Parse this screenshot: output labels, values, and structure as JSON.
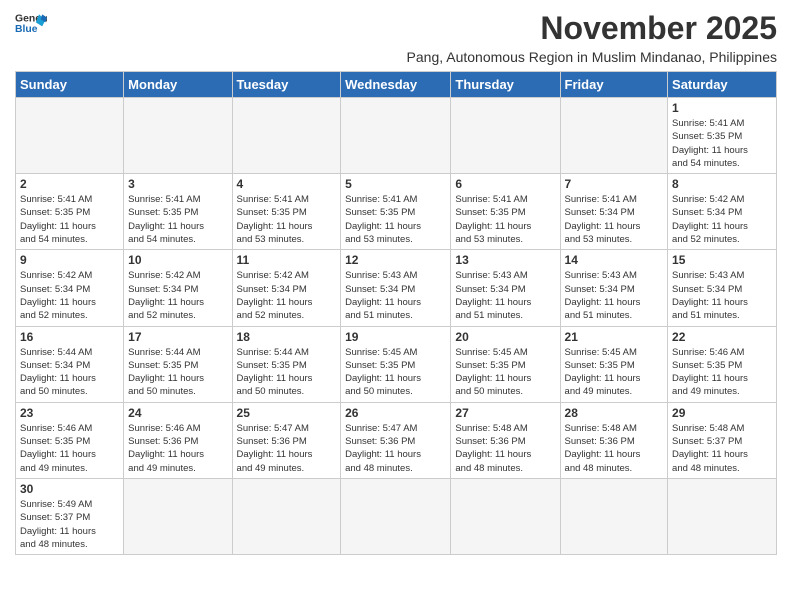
{
  "logo": {
    "line1": "General",
    "line2": "Blue"
  },
  "title": "November 2025",
  "subtitle": "Pang, Autonomous Region in Muslim Mindanao, Philippines",
  "days_of_week": [
    "Sunday",
    "Monday",
    "Tuesday",
    "Wednesday",
    "Thursday",
    "Friday",
    "Saturday"
  ],
  "weeks": [
    [
      {
        "day": "",
        "info": ""
      },
      {
        "day": "",
        "info": ""
      },
      {
        "day": "",
        "info": ""
      },
      {
        "day": "",
        "info": ""
      },
      {
        "day": "",
        "info": ""
      },
      {
        "day": "",
        "info": ""
      },
      {
        "day": "1",
        "info": "Sunrise: 5:41 AM\nSunset: 5:35 PM\nDaylight: 11 hours\nand 54 minutes."
      }
    ],
    [
      {
        "day": "2",
        "info": "Sunrise: 5:41 AM\nSunset: 5:35 PM\nDaylight: 11 hours\nand 54 minutes."
      },
      {
        "day": "3",
        "info": "Sunrise: 5:41 AM\nSunset: 5:35 PM\nDaylight: 11 hours\nand 54 minutes."
      },
      {
        "day": "4",
        "info": "Sunrise: 5:41 AM\nSunset: 5:35 PM\nDaylight: 11 hours\nand 53 minutes."
      },
      {
        "day": "5",
        "info": "Sunrise: 5:41 AM\nSunset: 5:35 PM\nDaylight: 11 hours\nand 53 minutes."
      },
      {
        "day": "6",
        "info": "Sunrise: 5:41 AM\nSunset: 5:35 PM\nDaylight: 11 hours\nand 53 minutes."
      },
      {
        "day": "7",
        "info": "Sunrise: 5:41 AM\nSunset: 5:34 PM\nDaylight: 11 hours\nand 53 minutes."
      },
      {
        "day": "8",
        "info": "Sunrise: 5:42 AM\nSunset: 5:34 PM\nDaylight: 11 hours\nand 52 minutes."
      }
    ],
    [
      {
        "day": "9",
        "info": "Sunrise: 5:42 AM\nSunset: 5:34 PM\nDaylight: 11 hours\nand 52 minutes."
      },
      {
        "day": "10",
        "info": "Sunrise: 5:42 AM\nSunset: 5:34 PM\nDaylight: 11 hours\nand 52 minutes."
      },
      {
        "day": "11",
        "info": "Sunrise: 5:42 AM\nSunset: 5:34 PM\nDaylight: 11 hours\nand 52 minutes."
      },
      {
        "day": "12",
        "info": "Sunrise: 5:43 AM\nSunset: 5:34 PM\nDaylight: 11 hours\nand 51 minutes."
      },
      {
        "day": "13",
        "info": "Sunrise: 5:43 AM\nSunset: 5:34 PM\nDaylight: 11 hours\nand 51 minutes."
      },
      {
        "day": "14",
        "info": "Sunrise: 5:43 AM\nSunset: 5:34 PM\nDaylight: 11 hours\nand 51 minutes."
      },
      {
        "day": "15",
        "info": "Sunrise: 5:43 AM\nSunset: 5:34 PM\nDaylight: 11 hours\nand 51 minutes."
      }
    ],
    [
      {
        "day": "16",
        "info": "Sunrise: 5:44 AM\nSunset: 5:34 PM\nDaylight: 11 hours\nand 50 minutes."
      },
      {
        "day": "17",
        "info": "Sunrise: 5:44 AM\nSunset: 5:35 PM\nDaylight: 11 hours\nand 50 minutes."
      },
      {
        "day": "18",
        "info": "Sunrise: 5:44 AM\nSunset: 5:35 PM\nDaylight: 11 hours\nand 50 minutes."
      },
      {
        "day": "19",
        "info": "Sunrise: 5:45 AM\nSunset: 5:35 PM\nDaylight: 11 hours\nand 50 minutes."
      },
      {
        "day": "20",
        "info": "Sunrise: 5:45 AM\nSunset: 5:35 PM\nDaylight: 11 hours\nand 50 minutes."
      },
      {
        "day": "21",
        "info": "Sunrise: 5:45 AM\nSunset: 5:35 PM\nDaylight: 11 hours\nand 49 minutes."
      },
      {
        "day": "22",
        "info": "Sunrise: 5:46 AM\nSunset: 5:35 PM\nDaylight: 11 hours\nand 49 minutes."
      }
    ],
    [
      {
        "day": "23",
        "info": "Sunrise: 5:46 AM\nSunset: 5:35 PM\nDaylight: 11 hours\nand 49 minutes."
      },
      {
        "day": "24",
        "info": "Sunrise: 5:46 AM\nSunset: 5:36 PM\nDaylight: 11 hours\nand 49 minutes."
      },
      {
        "day": "25",
        "info": "Sunrise: 5:47 AM\nSunset: 5:36 PM\nDaylight: 11 hours\nand 49 minutes."
      },
      {
        "day": "26",
        "info": "Sunrise: 5:47 AM\nSunset: 5:36 PM\nDaylight: 11 hours\nand 48 minutes."
      },
      {
        "day": "27",
        "info": "Sunrise: 5:48 AM\nSunset: 5:36 PM\nDaylight: 11 hours\nand 48 minutes."
      },
      {
        "day": "28",
        "info": "Sunrise: 5:48 AM\nSunset: 5:36 PM\nDaylight: 11 hours\nand 48 minutes."
      },
      {
        "day": "29",
        "info": "Sunrise: 5:48 AM\nSunset: 5:37 PM\nDaylight: 11 hours\nand 48 minutes."
      }
    ],
    [
      {
        "day": "30",
        "info": "Sunrise: 5:49 AM\nSunset: 5:37 PM\nDaylight: 11 hours\nand 48 minutes."
      },
      {
        "day": "",
        "info": ""
      },
      {
        "day": "",
        "info": ""
      },
      {
        "day": "",
        "info": ""
      },
      {
        "day": "",
        "info": ""
      },
      {
        "day": "",
        "info": ""
      },
      {
        "day": "",
        "info": ""
      }
    ]
  ]
}
